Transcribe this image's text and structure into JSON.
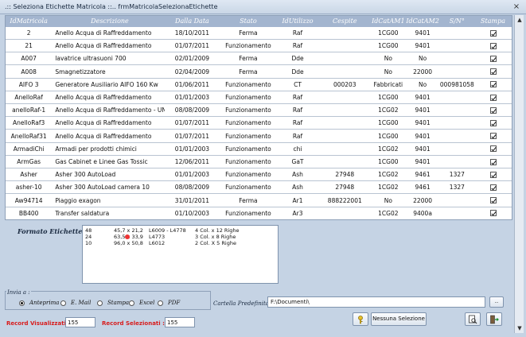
{
  "window": {
    "title": ".:: Seleziona Etichette Matricola ::..   frmMatricolaSelezionaEtichette",
    "close_glyph": "×"
  },
  "grid": {
    "headers": [
      "IdMatricola",
      "Descrizione",
      "Dalla Data",
      "Stato",
      "IdUtilizzo",
      "Cespite",
      "IdCatAM1",
      "IdCatAM2",
      "S/N°",
      "Stampa"
    ],
    "rows": [
      [
        "2",
        "Anello Acqua di Raffreddamento",
        "18/10/2011",
        "Ferma",
        "Raf",
        "",
        "1CG00",
        "9401",
        "",
        true
      ],
      [
        "21",
        "Anello Acqua di Raffreddamento",
        "01/07/2011",
        "Funzionamento",
        "Raf",
        "",
        "1CG00",
        "9401",
        "",
        true
      ],
      [
        "A007",
        "lavatrice ultrasuoni  700",
        "02/01/2009",
        "Ferma",
        "Dde",
        "",
        "No",
        "No",
        "",
        true
      ],
      [
        "A008",
        "Smagnetizzatore",
        "02/04/2009",
        "Ferma",
        "Dde",
        "",
        "No",
        "22000",
        "",
        true
      ],
      [
        "AIFO 3",
        "Generatore Ausiliario AIFO  160 Kw",
        "01/06/2011",
        "Funzionamento",
        "CT",
        "000203",
        "Fabbricati",
        "No",
        "000981058",
        true
      ],
      [
        "AnelloRaf",
        "Anello Acqua di Raffreddamento",
        "01/01/2003",
        "Funzionamento",
        "Raf",
        "",
        "1CG00",
        "9401",
        "",
        true
      ],
      [
        "anelloRaf-1",
        "Anello Acqua di Raffreddamento - UNO",
        "08/08/2009",
        "Funzionamento",
        "Raf",
        "",
        "1CG02",
        "9401",
        "",
        true
      ],
      [
        "AnelloRaf3",
        "Anello Acqua di Raffreddamento",
        "01/07/2011",
        "Funzionamento",
        "Raf",
        "",
        "1CG00",
        "9401",
        "",
        true
      ],
      [
        "AnelloRaf31",
        "Anello Acqua di Raffreddamento",
        "01/07/2011",
        "Funzionamento",
        "Raf",
        "",
        "1CG00",
        "9401",
        "",
        true
      ],
      [
        "ArmadiChi",
        "Armadi per prodotti chimici",
        "01/01/2003",
        "Funzionamento",
        "chi",
        "",
        "1CG02",
        "9401",
        "",
        true
      ],
      [
        "ArmGas",
        "Gas Cabinet e Linee Gas Tossic",
        "12/06/2011",
        "Funzionamento",
        "GaT",
        "",
        "1CG00",
        "9401",
        "",
        true
      ],
      [
        "Asher",
        "Asher 300 AutoLoad",
        "01/01/2003",
        "Funzionamento",
        "Ash",
        "27948",
        "1CG02",
        "9461",
        "1327",
        true
      ],
      [
        "asher-10",
        "Asher 300 AutoLoad camera 10",
        "08/08/2009",
        "Funzionamento",
        "Ash",
        "27948",
        "1CG02",
        "9461",
        "1327",
        true
      ],
      [
        "Aw94714",
        "Piaggio exagon",
        "31/01/2011",
        "Ferma",
        "Ar1",
        "888222001",
        "No",
        "22000",
        "",
        true
      ],
      [
        "BB400",
        "Transfer saldatura",
        "01/10/2003",
        "Funzionamento",
        "Ar3",
        "",
        "1CG02",
        "9400a",
        "",
        true
      ]
    ]
  },
  "formato": {
    "label": "Formato Etichette :",
    "rows": [
      [
        "48",
        "45,7 x 21,2",
        "L6009 - L4778",
        "4 Col. x 12 Righe"
      ],
      [
        "24",
        "63,5 x 33,9",
        "L4773",
        "3 Col. x 8 Righe"
      ],
      [
        "10",
        "96,0 x 50,8",
        "L6012",
        "2 Col. X 5 Righe"
      ]
    ]
  },
  "invia": {
    "label": "Invia a :",
    "options": [
      "Anteprima",
      "E. Mail",
      "Stampa",
      "Excel",
      "PDF"
    ],
    "selected": "Anteprima"
  },
  "cartella": {
    "label": "Cartella Predefinita :",
    "value": "F:\\Documenti\\",
    "browse_label": ".."
  },
  "records": {
    "visualizzati_label": "Record Visualizzati :",
    "visualizzati_value": "155",
    "selezionati_label": "Record Selezionati :",
    "selezionati_value": "155"
  },
  "buttons": {
    "nessuna_label": "Nessuna Selezione"
  },
  "scrollbar": {
    "up": "▲",
    "down": "▼"
  },
  "colors": {
    "background": "#c5d3e4",
    "header": "#a3b5cf",
    "record_label": "#d81c1c"
  }
}
